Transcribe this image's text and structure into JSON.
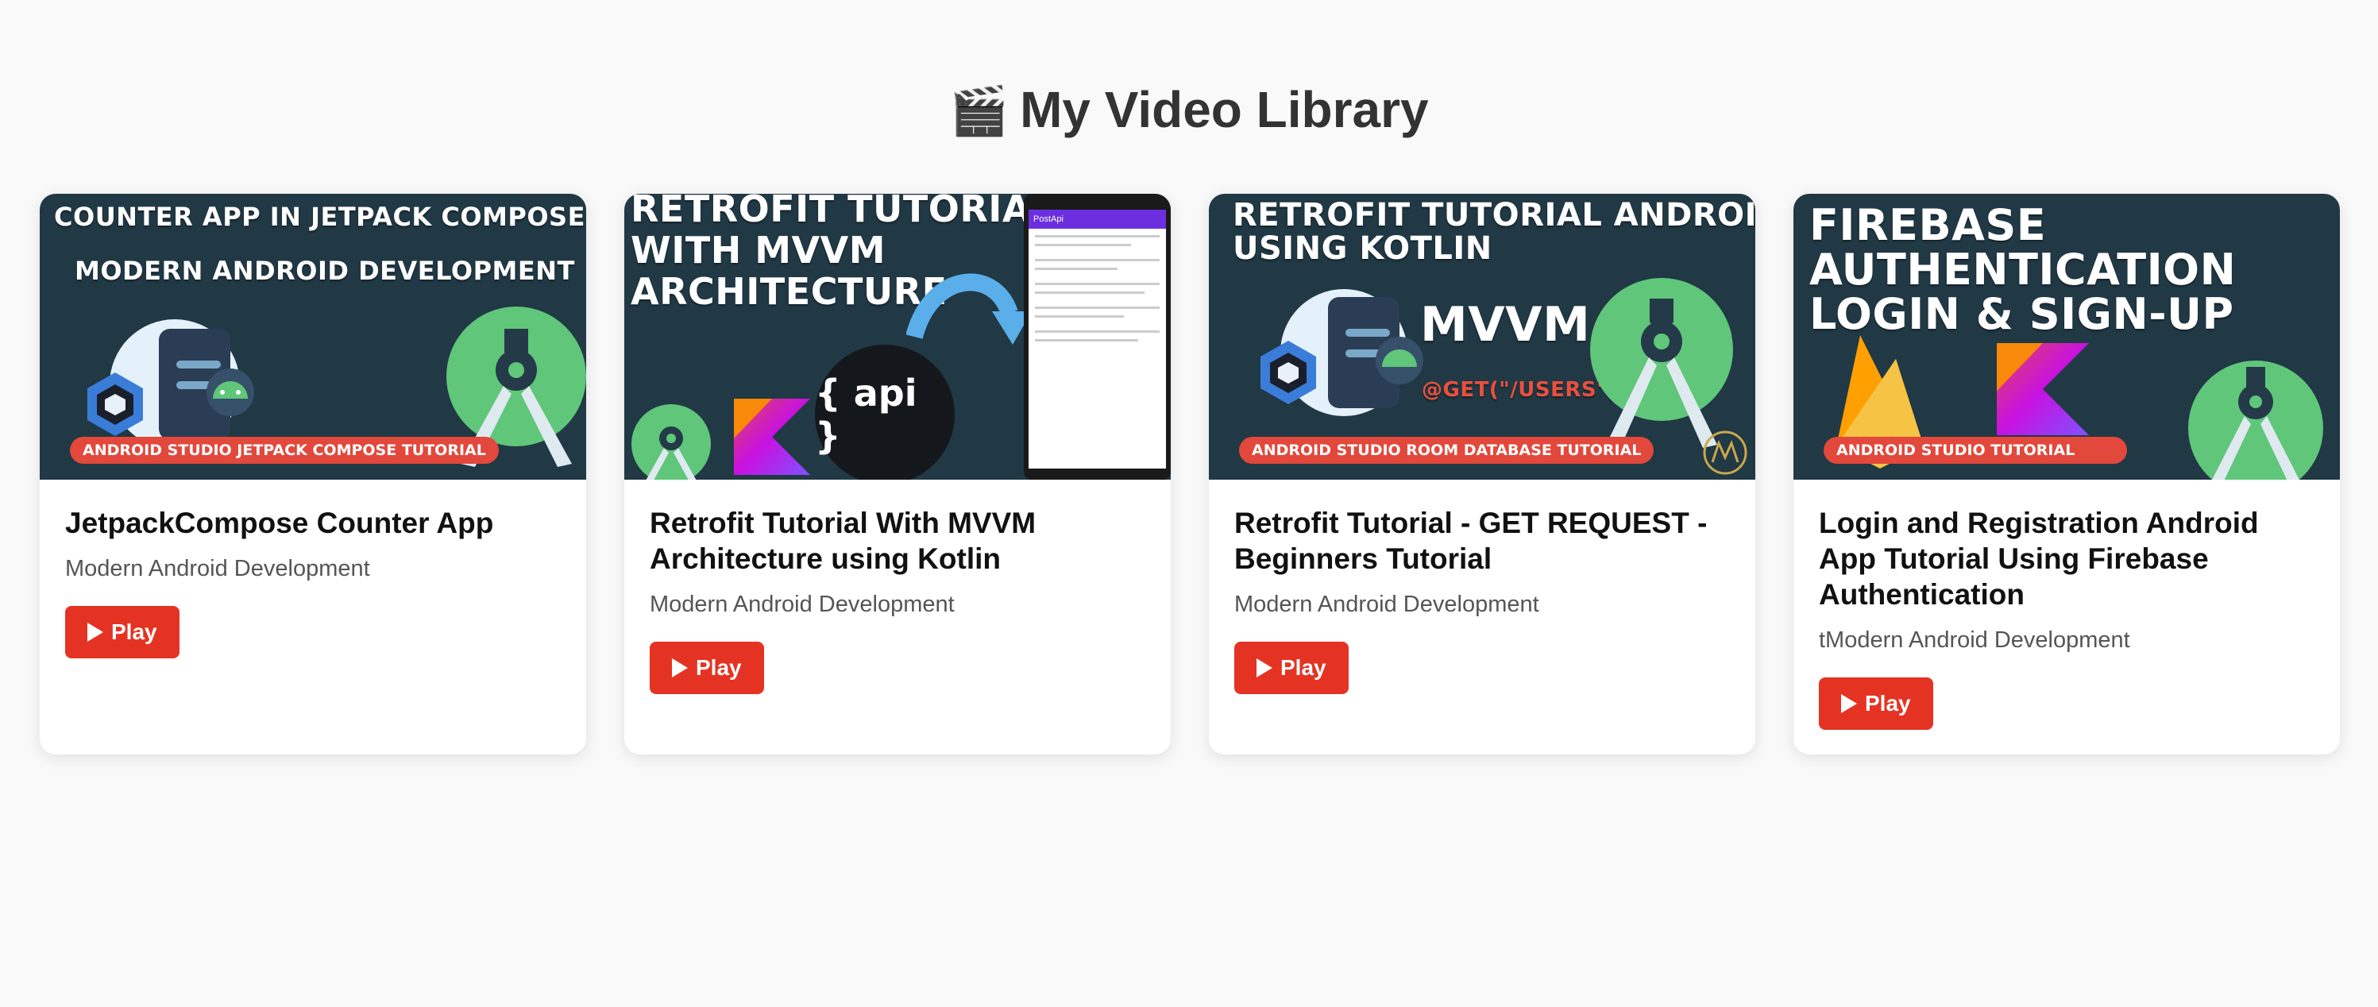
{
  "page": {
    "title_emoji": "🎬",
    "title": "My Video Library"
  },
  "play_label": "Play",
  "colors": {
    "background": "#f9f9f9",
    "thumbnail_bg": "#213845",
    "play_button": "#e53323",
    "banner": "#e2483b"
  },
  "videos": [
    {
      "title": "JetpackCompose Counter App",
      "subtitle": "Modern Android Development",
      "thumb_lines": [
        "COUNTER APP IN JETPACK COMPOSE",
        "MODERN ANDROID DEVELOPMENT"
      ],
      "thumb_banner": "ANDROID STUDIO JETPACK COMPOSE TUTORIAL"
    },
    {
      "title": "Retrofit Tutorial With MVVM Architecture using Kotlin",
      "subtitle": "Modern Android Development",
      "thumb_lines": [
        "RETROFIT TUTORIAL",
        "WITH MVVM",
        "ARCHITECTURE"
      ],
      "thumb_badge": "{ api }",
      "thumb_phone_title": "PostApi"
    },
    {
      "title": "Retrofit Tutorial - GET REQUEST - Beginners Tutorial",
      "subtitle": "Modern Android Development",
      "thumb_lines": [
        "RETROFIT TUTORIAL ANDROID",
        "USING KOTLIN"
      ],
      "thumb_mvvm": "MVVM",
      "thumb_get": "@GET(\"/USERS\")",
      "thumb_banner": "ANDROID STUDIO ROOM DATABASE TUTORIAL"
    },
    {
      "title": "Login and Registration Android App Tutorial Using Firebase Authentication",
      "subtitle": "tModern Android Development",
      "thumb_lines": [
        "FIREBASE",
        "AUTHENTICATION",
        "LOGIN & SIGN-UP"
      ],
      "thumb_banner": "ANDROID STUDIO TUTORIAL"
    }
  ]
}
